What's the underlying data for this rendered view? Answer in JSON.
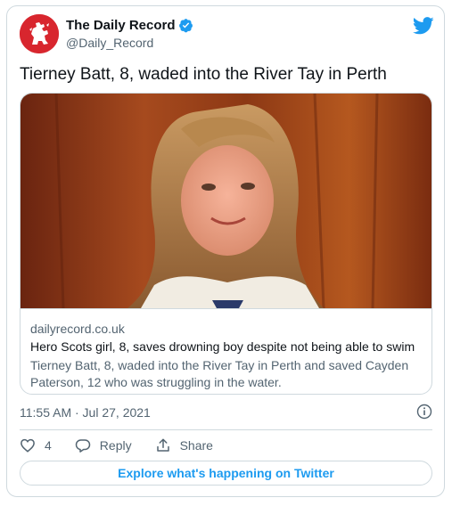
{
  "account": {
    "name": "The Daily Record",
    "handle": "@Daily_Record",
    "verified": true,
    "avatar_color": "#d8262e"
  },
  "tweet": {
    "text": "Tierney Batt, 8, waded into the River Tay in Perth"
  },
  "link_card": {
    "domain": "dailyrecord.co.uk",
    "title": "Hero Scots girl, 8, saves drowning boy despite not being able to swim",
    "description": "Tierney Batt, 8, waded into the River Tay in Perth and saved Cayden Paterson, 12 who was struggling in the water."
  },
  "meta": {
    "timestamp": "11:55 AM · Jul 27, 2021"
  },
  "actions": {
    "like_count": "4",
    "reply_label": "Reply",
    "share_label": "Share"
  },
  "explore": {
    "label": "Explore what's happening on Twitter"
  },
  "colors": {
    "twitter_blue": "#1d9bf0",
    "secondary_text": "#536471",
    "border": "#cfd9de"
  },
  "icons": [
    "lion-rampant-icon",
    "verified-badge-icon",
    "twitter-bird-icon",
    "info-icon",
    "heart-icon",
    "reply-icon",
    "share-icon"
  ]
}
